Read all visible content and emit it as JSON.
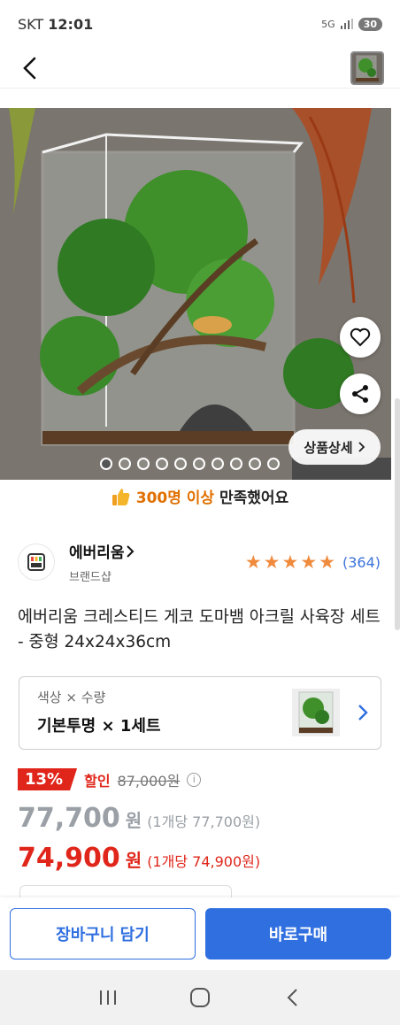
{
  "status_bar": {
    "carrier": "SKT",
    "time": "12:01",
    "network": "5G",
    "battery": "30"
  },
  "nav": {
    "back_icon": "chevron-left-icon",
    "thumbnail_icon": "product-thumbnail"
  },
  "hero": {
    "dots_total": 10,
    "dots_active_index": 0,
    "detail_button": "상품상세",
    "colors": {
      "wall": "#6f6a64",
      "leaf": "#3f8f2a",
      "wood": "#6a4a2e"
    }
  },
  "social_proof": {
    "highlight": "300명 이상",
    "rest": " 만족했어요",
    "icon": "thumbs-up-icon"
  },
  "brand": {
    "name": "에버리움",
    "sub": "브랜드샵",
    "rating_stars": 5,
    "review_count": "(364)"
  },
  "product": {
    "title": "에버리움 크레스티드 게코 도마뱀 아크릴 사육장 세트 - 중형 24x24x36cm"
  },
  "option": {
    "label": "색상 × 수량",
    "value": "기본투명 × 1세트"
  },
  "price": {
    "discount_pct": "13%",
    "discount_label": "할인",
    "original": "87,000원",
    "price1_num": "77,700",
    "price1_won": "원",
    "price1_unit": "(1개당 77,700원)",
    "price2_num": "74,900",
    "price2_won": "원",
    "price2_unit": "(1개당 74,900원)"
  },
  "actions": {
    "cart": "장바구니 담기",
    "buy": "바로구매"
  },
  "theme": {
    "accent": "#2f6fe0",
    "sale": "#e0261a",
    "star": "#f08a3c",
    "proof": "#e07000"
  }
}
